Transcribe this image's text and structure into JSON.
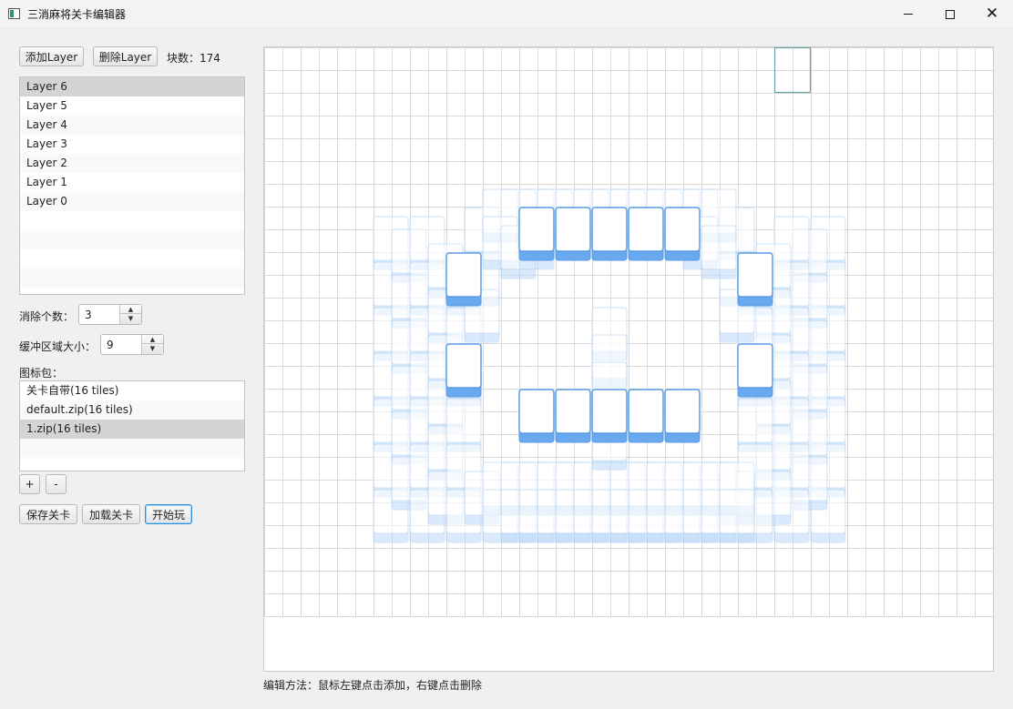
{
  "window": {
    "title": "三消麻将关卡编辑器",
    "controls": [
      "minimize",
      "maximize",
      "close"
    ]
  },
  "toolbar": {
    "add_layer": "添加Layer",
    "delete_layer": "删除Layer",
    "block_count_label": "块数：174"
  },
  "layers": {
    "items": [
      "Layer 6",
      "Layer 5",
      "Layer 4",
      "Layer 3",
      "Layer 2",
      "Layer 1",
      "Layer 0"
    ],
    "selected": "Layer 6"
  },
  "eliminate": {
    "label": "消除个数：",
    "value": "3"
  },
  "buffer": {
    "label": "缓冲区域大小：",
    "value": "9"
  },
  "icon_pack": {
    "label": "图标包：",
    "items": [
      "关卡自带(16 tiles)",
      "default.zip(16 tiles)",
      "1.zip(16 tiles)"
    ],
    "selected": "1.zip(16 tiles)",
    "add_label": "+",
    "remove_label": "-"
  },
  "actions": {
    "save": "保存关卡",
    "load": "加载关卡",
    "play": "开始玩"
  },
  "hint": "编辑方法：鼠标左键点击添加，右键点击删除",
  "colors": {
    "tile_face": "#ffffff",
    "tile_border": "#5b9be6",
    "tile_base": "#6aa9f0",
    "faded_border": "#a9cdf3",
    "faded_base": "#bcd9f7",
    "grid_line": "#d9d9d9",
    "hover_cell": "#6aa3a3"
  },
  "icons": {
    "app": "app-window-icon",
    "minimize": "minimize-icon",
    "maximize": "maximize-icon",
    "close": "close-icon",
    "spin_up": "spin-up-arrow-icon",
    "spin_down": "spin-down-arrow-icon"
  }
}
